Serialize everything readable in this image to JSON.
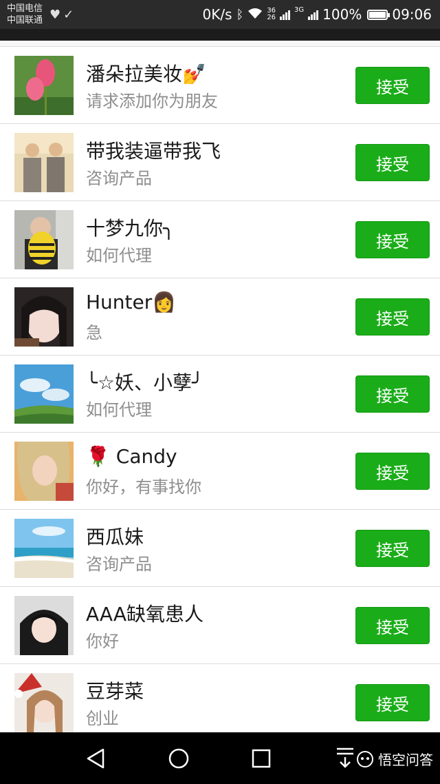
{
  "status_bar": {
    "carrier1": "中国电信",
    "carrier2": "中国联通",
    "speed": "0K/s",
    "net1": "36",
    "net2": "26",
    "net3": "3G",
    "battery": "100%",
    "time": "09:06"
  },
  "requests": [
    {
      "name": "潘朵拉美妆💅",
      "message": "请求添加你为朋友",
      "button": "接受"
    },
    {
      "name": "带我装逼带我飞",
      "message": "咨询产品",
      "button": "接受"
    },
    {
      "name": "十梦九你╮",
      "message": "如何代理",
      "button": "接受"
    },
    {
      "name": "Hunter👩",
      "message": "急",
      "button": "接受"
    },
    {
      "name": "╰☆妖、小孽╯",
      "message": "如何代理",
      "button": "接受"
    },
    {
      "name": "🌹 Candy",
      "message": "你好，有事找你",
      "button": "接受"
    },
    {
      "name": "西瓜妹",
      "message": "咨询产品",
      "button": "接受"
    },
    {
      "name": "AAA缺氧患人",
      "message": "你好",
      "button": "接受"
    },
    {
      "name": "豆芽菜",
      "message": "创业",
      "button": "接受"
    }
  ],
  "watermark": "悟空问答",
  "colors": {
    "accept_button": "#1aad19",
    "status_bar": "#2b2b2b",
    "nav_bar": "#000000"
  }
}
